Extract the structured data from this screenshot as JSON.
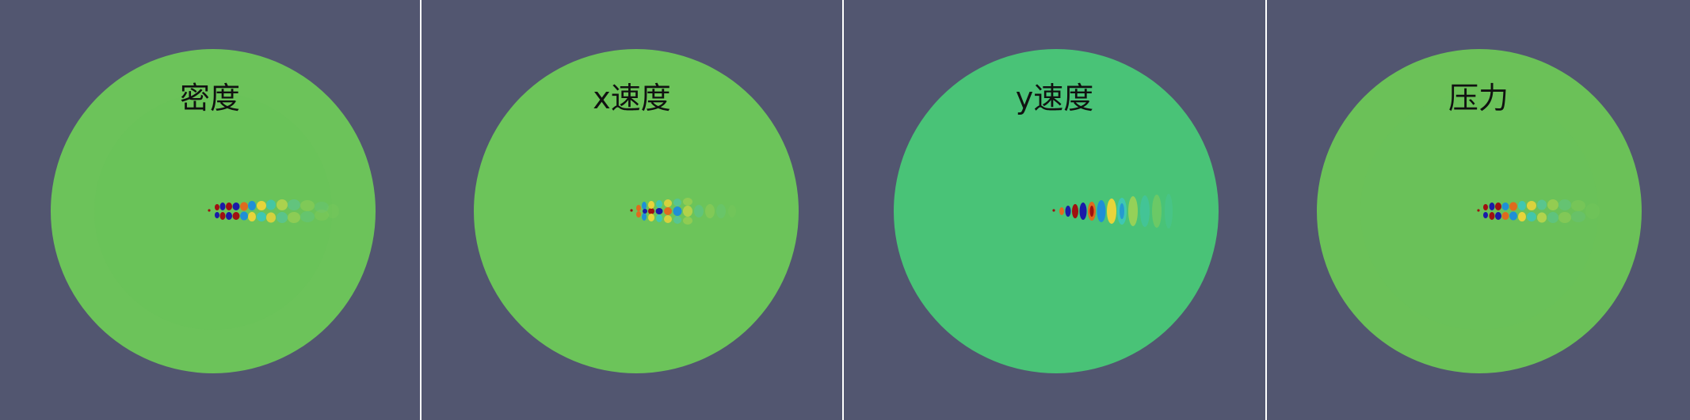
{
  "colors": {
    "background": "#525670",
    "separator": "#ffffff",
    "disk_default": "#6cc35a",
    "colormap": [
      "#1a1aa8",
      "#1f8fd6",
      "#3fc7b2",
      "#6cc35a",
      "#e8d43a",
      "#e06a1e",
      "#a01010"
    ]
  },
  "panels": [
    {
      "title": "密度",
      "field": "density",
      "disk_color": "#6cc35a"
    },
    {
      "title": "x速度",
      "field": "x-velocity",
      "disk_color": "#6cc45a"
    },
    {
      "title": "y速度",
      "field": "y-velocity",
      "disk_color": "#49c377"
    },
    {
      "title": "压力",
      "field": "pressure",
      "disk_color": "#6bc158"
    }
  ]
}
